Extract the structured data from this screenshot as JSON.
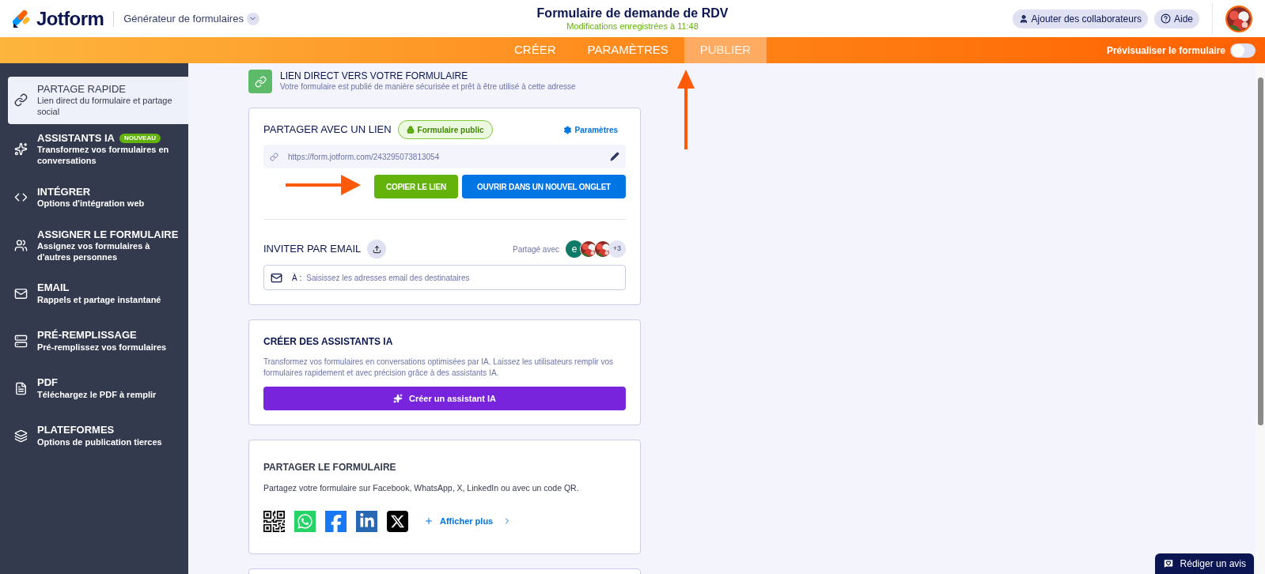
{
  "header": {
    "logo_text": "Jotform",
    "product": "Générateur de formulaires",
    "title": "Formulaire de demande de RDV",
    "saved_status": "Modifications enregistrées à 11:48",
    "buttons": [
      {
        "kind": "user",
        "label": "Ajouter des collaborateurs"
      },
      {
        "kind": "help",
        "label": "Aide"
      }
    ]
  },
  "nav": {
    "tabs": [
      {
        "label": "CRÉER",
        "selected": false
      },
      {
        "label": "PARAMÈTRES",
        "selected": false
      },
      {
        "label": "PUBLIER",
        "selected": true
      }
    ],
    "preview": {
      "label": "Prévisualiser le formulaire",
      "on": false
    }
  },
  "sidebar": {
    "items": [
      {
        "kind": "link",
        "title": "PARTAGE RAPIDE",
        "subtitle": "Lien direct du formulaire et partage social",
        "selected": true
      },
      {
        "kind": "sparkles",
        "title": "ASSISTANTS IA",
        "badge": "NOUVEAU",
        "subtitle": "Transformez vos formulaires en conversations",
        "selected": false
      },
      {
        "kind": "code",
        "title": "INTÉGRER",
        "subtitle": "Options d'intégration web",
        "selected": false
      },
      {
        "kind": "users",
        "title": "ASSIGNER LE FORMULAIRE",
        "subtitle": "Assignez vos formulaires à d'autres personnes",
        "selected": false
      },
      {
        "kind": "mail",
        "title": "EMAIL",
        "subtitle": "Rappels et partage instantané",
        "selected": false
      },
      {
        "kind": "prefill",
        "title": "PRÉ-REMPLISSAGE",
        "subtitle": "Pré-remplissez vos formulaires",
        "selected": false
      },
      {
        "kind": "pdf",
        "title": "PDF",
        "subtitle": "Téléchargez le PDF à remplir",
        "selected": false
      },
      {
        "kind": "layers",
        "title": "PLATEFORMES",
        "subtitle": "Options de publication tierces",
        "selected": false
      }
    ]
  },
  "direct_link": {
    "title": "LIEN DIRECT VERS VOTRE FORMULAIRE",
    "subtitle": "Votre formulaire est publié de manière sécurisée et prêt à être utilisé à cette adresse"
  },
  "share_link": {
    "title": "PARTAGER AVEC UN LIEN",
    "visibility": "Formulaire public",
    "settings": "Paramètres",
    "url": "https://form.jotform.com/243295073813054",
    "buttons": [
      {
        "kind": "copy",
        "label": "COPIER LE LIEN"
      },
      {
        "kind": "open",
        "label": "OUVRIR DANS UN NOUVEL ONGLET"
      }
    ]
  },
  "invite": {
    "title": "INVITER PAR EMAIL",
    "shared_label": "Partagé avec",
    "avatars": [
      {
        "kind": "letter",
        "text": "e",
        "color": "#0f7a68"
      },
      {
        "kind": "picture"
      },
      {
        "kind": "picture"
      },
      {
        "kind": "count",
        "text": "+3"
      }
    ],
    "to_label": "À :",
    "placeholder": "Saisissez les adresses email des destinataires"
  },
  "ai_card": {
    "title": "CRÉER DES ASSISTANTS IA",
    "description": "Transformez vos formulaires en conversations optimisées par IA. Laissez les utilisateurs remplir vos formulaires rapidement et avec précision grâce à des assistants IA.",
    "button": "Créer un assistant IA"
  },
  "share_form": {
    "title": "PARTAGER LE FORMULAIRE",
    "description": "Partagez votre formulaire sur Facebook, WhatsApp, X, LinkedIn ou avec un code QR.",
    "socials": [
      {
        "kind": "qr"
      },
      {
        "kind": "whatsapp"
      },
      {
        "kind": "facebook"
      },
      {
        "kind": "linkedin"
      },
      {
        "kind": "x"
      }
    ],
    "more": "Afficher plus"
  },
  "feedback": {
    "label": "Rédiger un avis"
  }
}
